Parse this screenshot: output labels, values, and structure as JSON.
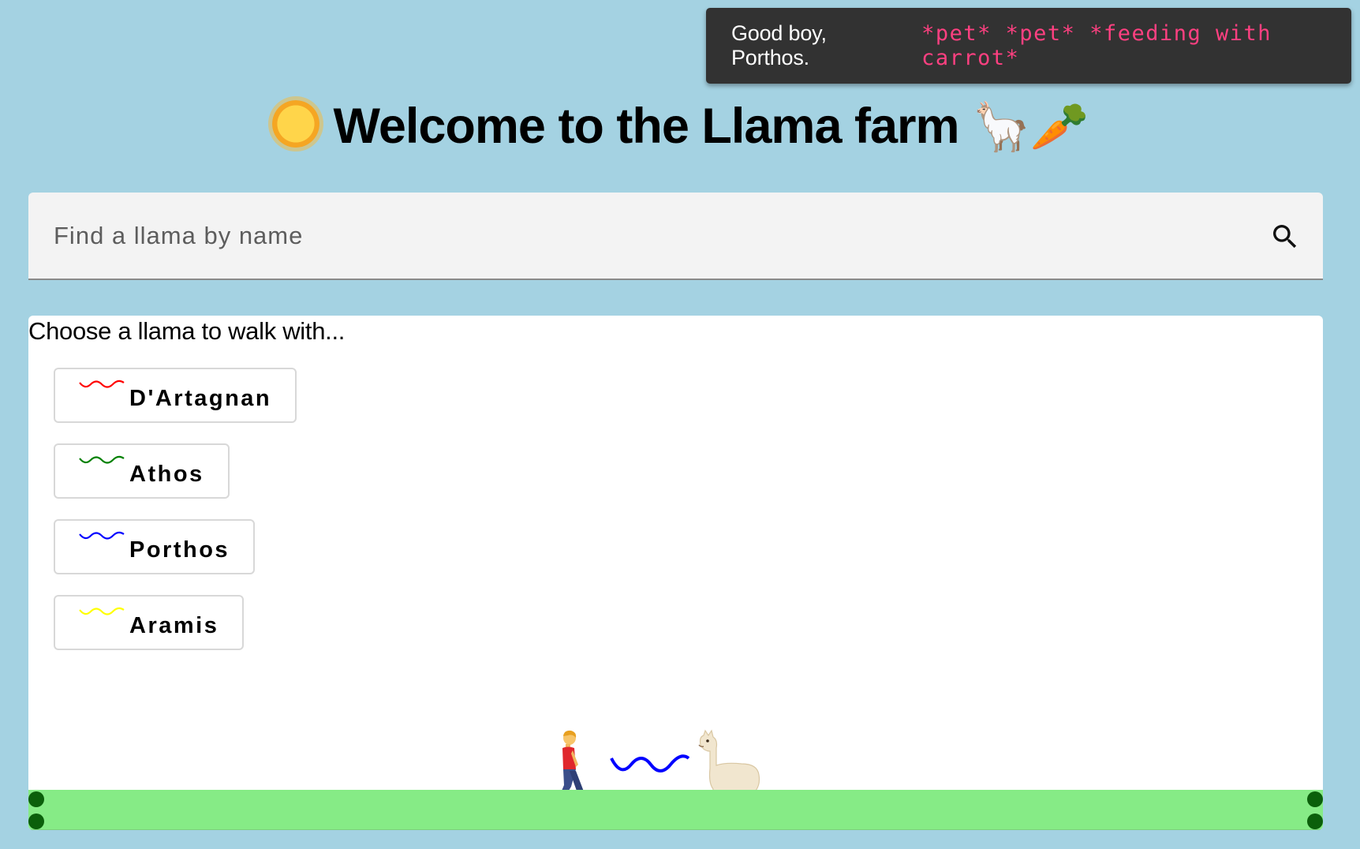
{
  "toast": {
    "message": "Good boy, Porthos.",
    "action": "*pet* *pet* *feeding with carrot*",
    "action_color": "#ff4081"
  },
  "header": {
    "title": "Welcome to the Llama farm",
    "leading_icon": "sun-face-icon",
    "trailing_emoji": "🦙🥕"
  },
  "search": {
    "placeholder": "Find a llama by name",
    "value": "",
    "icon": "search-icon"
  },
  "main": {
    "prompt": "Choose a llama to walk with...",
    "llamas": [
      {
        "name": "D'Artagnan",
        "color": "#ff0000"
      },
      {
        "name": "Athos",
        "color": "#008000"
      },
      {
        "name": "Porthos",
        "color": "#0000ff"
      },
      {
        "name": "Aramis",
        "color": "#ffff00"
      }
    ],
    "scene": {
      "walker_icon": "person-walking-icon",
      "leash_color": "#0000ff",
      "llama_icon": "llama-icon",
      "ground_color": "#86eb86"
    }
  },
  "colors": {
    "background": "#a4d2e2",
    "toast_background": "#323232",
    "card_background": "#ffffff"
  }
}
